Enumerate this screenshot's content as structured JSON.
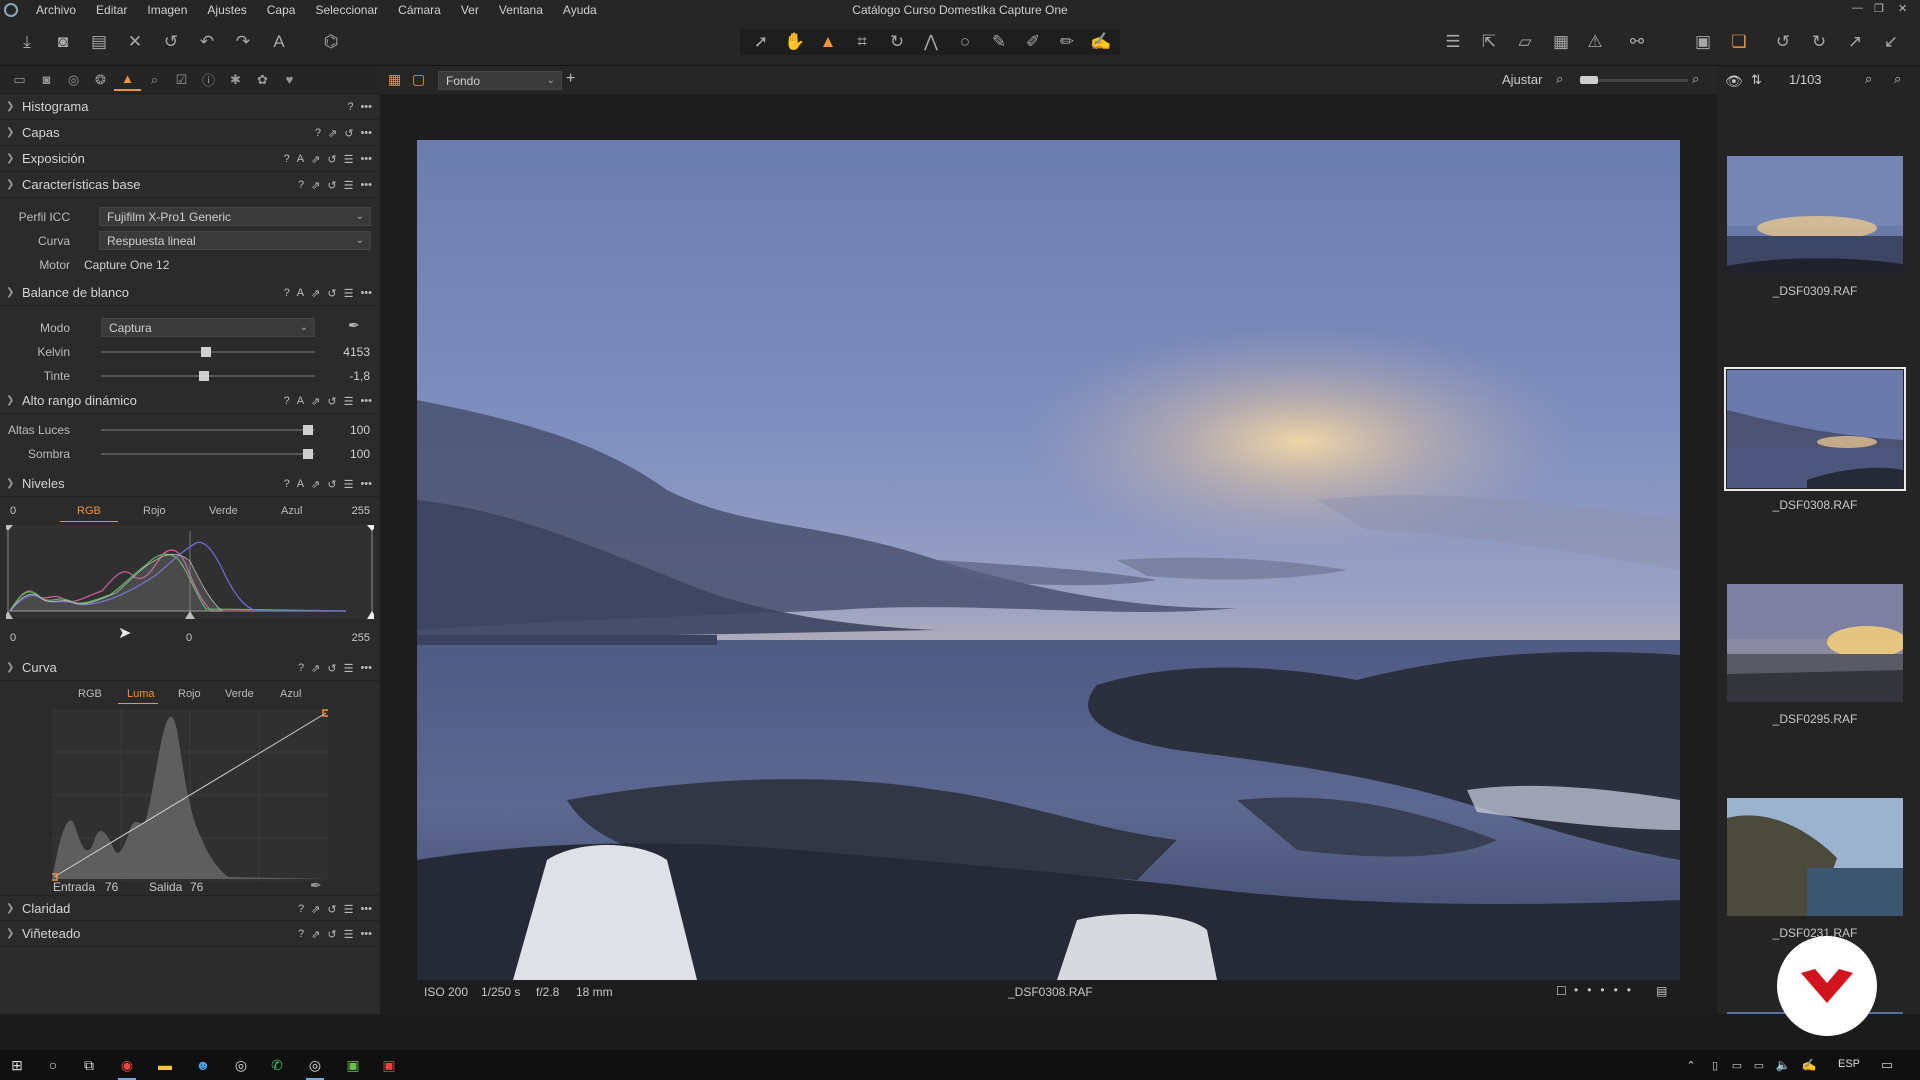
{
  "window": {
    "title": "Catálogo Curso Domestika Capture One",
    "menu": [
      "Archivo",
      "Editar",
      "Imagen",
      "Ajustes",
      "Capa",
      "Seleccionar",
      "Cámara",
      "Ver",
      "Ventana",
      "Ayuda"
    ]
  },
  "viewer_toolbar": {
    "background_label": "Fondo",
    "fit_label": "Ajustar",
    "counter": "1/103"
  },
  "sections": {
    "histograma": "Histograma",
    "capas": "Capas",
    "exposicion": "Exposición",
    "caracteristicas": {
      "title": "Características base",
      "icc_label": "Perfil ICC",
      "icc_value": "Fujifilm X-Pro1 Generic",
      "curva_label": "Curva",
      "curva_value": "Respuesta lineal",
      "motor_label": "Motor",
      "motor_value": "Capture One 12"
    },
    "balance": {
      "title": "Balance de blanco",
      "modo_label": "Modo",
      "modo_value": "Captura",
      "kelvin_label": "Kelvin",
      "kelvin_value": "4153",
      "kelvin_level": 0.49,
      "tinte_label": "Tinte",
      "tinte_value": "-1,8",
      "tinte_level": 0.48
    },
    "hdr": {
      "title": "Alto rango dinámico",
      "altas_label": "Altas Luces",
      "altas_value": "100",
      "sombra_label": "Sombra",
      "sombra_value": "100"
    },
    "niveles": {
      "title": "Niveles",
      "tabs": [
        "RGB",
        "Rojo",
        "Verde",
        "Azul"
      ],
      "active_tab": "RGB",
      "top_left": "0",
      "top_right": "255",
      "bottom_left": "0",
      "bottom_mid": "0",
      "bottom_right": "255"
    },
    "curva": {
      "title": "Curva",
      "tabs": [
        "RGB",
        "Luma",
        "Rojo",
        "Verde",
        "Azul"
      ],
      "active_tab": "Luma",
      "entrada_label": "Entrada",
      "entrada_value": "76",
      "salida_label": "Salida",
      "salida_value": "76"
    },
    "claridad": "Claridad",
    "vineteado": "Viñeteado"
  },
  "viewer_status": {
    "iso": "ISO 200",
    "shutter": "1/250 s",
    "aperture": "f/2.8",
    "focal": "18 mm",
    "filename": "_DSF0308.RAF"
  },
  "browser": {
    "thumbs": [
      {
        "name": "_DSF0309.RAF",
        "selected": false
      },
      {
        "name": "_DSF0308.RAF",
        "selected": true
      },
      {
        "name": "_DSF0295.RAF",
        "selected": false
      },
      {
        "name": "_DSF0231.RAF",
        "selected": false
      }
    ]
  },
  "taskbar": {
    "language": "ESP"
  },
  "colors": {
    "accent": "#f0923a",
    "panel": "#2b2b2b",
    "logo_red": "#d2141e"
  }
}
